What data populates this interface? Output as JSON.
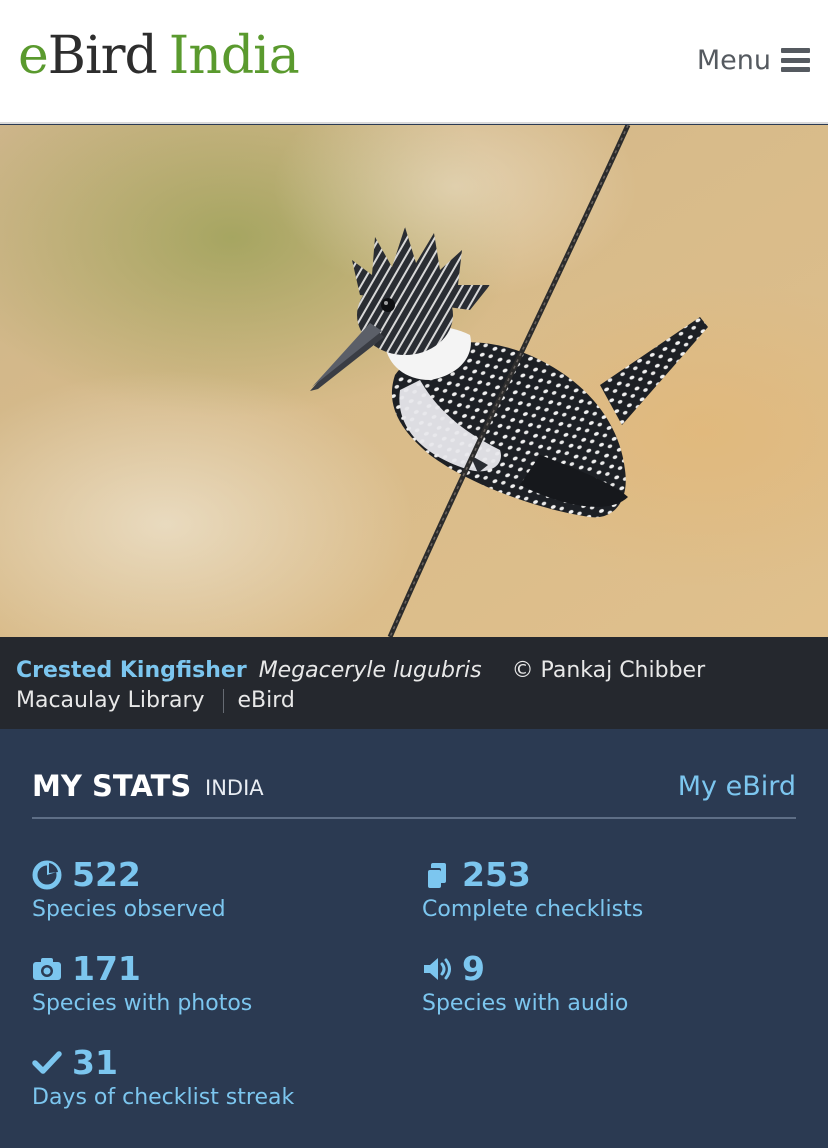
{
  "header": {
    "logo_e": "e",
    "logo_bird": "Bird",
    "logo_region": "India",
    "menu_label": "Menu",
    "menu_icon": "hamburger-icon"
  },
  "hero": {
    "subject": "Crested Kingfisher perched on a wire"
  },
  "caption": {
    "common_name": "Crested Kingfisher",
    "scientific_name": "Megaceryle lugubris",
    "credit": "© Pankaj Chibber",
    "library": "Macaulay Library",
    "source": "eBird"
  },
  "stats": {
    "title": "MY STATS",
    "region": "INDIA",
    "link": "My eBird",
    "items": [
      {
        "icon": "species-pie-icon",
        "value": "522",
        "label": "Species observed"
      },
      {
        "icon": "checklists-icon",
        "value": "253",
        "label": "Complete checklists"
      },
      {
        "icon": "camera-icon",
        "value": "171",
        "label": "Species with photos"
      },
      {
        "icon": "speaker-icon",
        "value": "9",
        "label": "Species with audio"
      },
      {
        "icon": "checkmark-icon",
        "value": "31",
        "label": "Days of checklist streak"
      }
    ]
  },
  "colors": {
    "brand_green": "#5a9a2e",
    "link_blue": "#7cc6ef",
    "stats_bg": "#2b3a52",
    "caption_bg": "#25282e"
  }
}
